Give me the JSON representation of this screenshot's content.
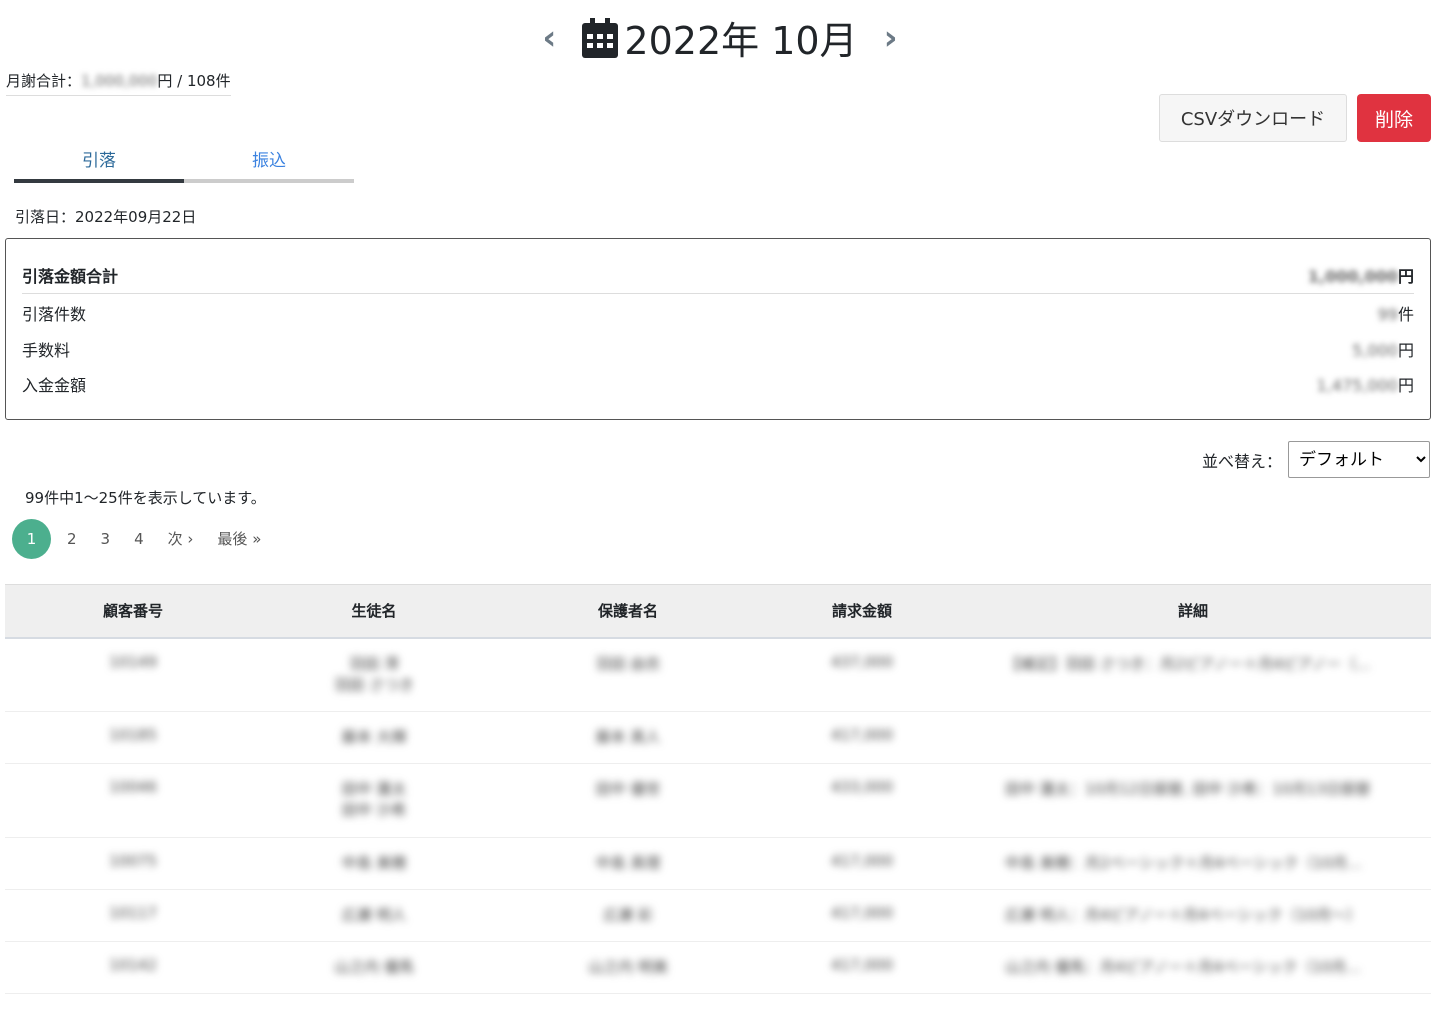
{
  "header": {
    "title": "2022年 10月",
    "prev": "‹",
    "next": "›"
  },
  "monthly": {
    "label": "月謝合計：",
    "amount": "1,000,000",
    "unit": "円 / 108件"
  },
  "buttons": {
    "csv": "CSVダウンロード",
    "delete": "削除"
  },
  "tabs": [
    {
      "label": "引落"
    },
    {
      "label": "振込"
    }
  ],
  "debit_date": "引落日：2022年09月22日",
  "summary": [
    {
      "label": "引落金額合計",
      "value": "1,000,000",
      "unit": "円"
    },
    {
      "label": "引落件数",
      "value": "99",
      "unit": "件"
    },
    {
      "label": "手数料",
      "value": "5,000",
      "unit": "円"
    },
    {
      "label": "入金金額",
      "value": "1,475,000",
      "unit": "円"
    }
  ],
  "sort": {
    "label": "並べ替え：",
    "selected": "デフォルト"
  },
  "count_text": "99件中1〜25件を表示しています。",
  "pager": {
    "pages": [
      "1",
      "2",
      "3",
      "4"
    ],
    "next": "次 ›",
    "last": "最後 »"
  },
  "table": {
    "headers": [
      "顧客番号",
      "生徒名",
      "保護者名",
      "請求金額",
      "詳細"
    ],
    "rows": [
      {
        "id": "10149",
        "student": "羽田 澪\n羽田 さつき",
        "guardian": "羽田 由衣",
        "amount": "437,000",
        "detail": "【補足】羽田 さつき：月2ピアノー＋月4ピアノー（..."
      },
      {
        "id": "10185",
        "student": "藤本 大輝",
        "guardian": "藤本 真人",
        "amount": "417,000",
        "detail": ""
      },
      {
        "id": "10046",
        "student": "田中 蓮太\n田中 沙希",
        "guardian": "田中 優世",
        "amount": "433,000",
        "detail": "田中 蓮太：10月12日振替, 田中 沙希：10月13日振替"
      },
      {
        "id": "10075",
        "student": "中島 美穂",
        "guardian": "中島 真理",
        "amount": "417,000",
        "detail": "中島 美穂：月2ベーシック＋月4ベーシック（10月..."
      },
      {
        "id": "10117",
        "student": "広瀬 明人",
        "guardian": "広瀬 彩",
        "amount": "417,000",
        "detail": "広瀬 明人：月4ピアノー＋月4ベーシック（10月～）"
      },
      {
        "id": "10142",
        "student": "山之内 優馬",
        "guardian": "山之内 明美",
        "amount": "417,000",
        "detail": "山之内 優馬：月4ピアノー＋月4ベーシック（10月..."
      }
    ]
  }
}
